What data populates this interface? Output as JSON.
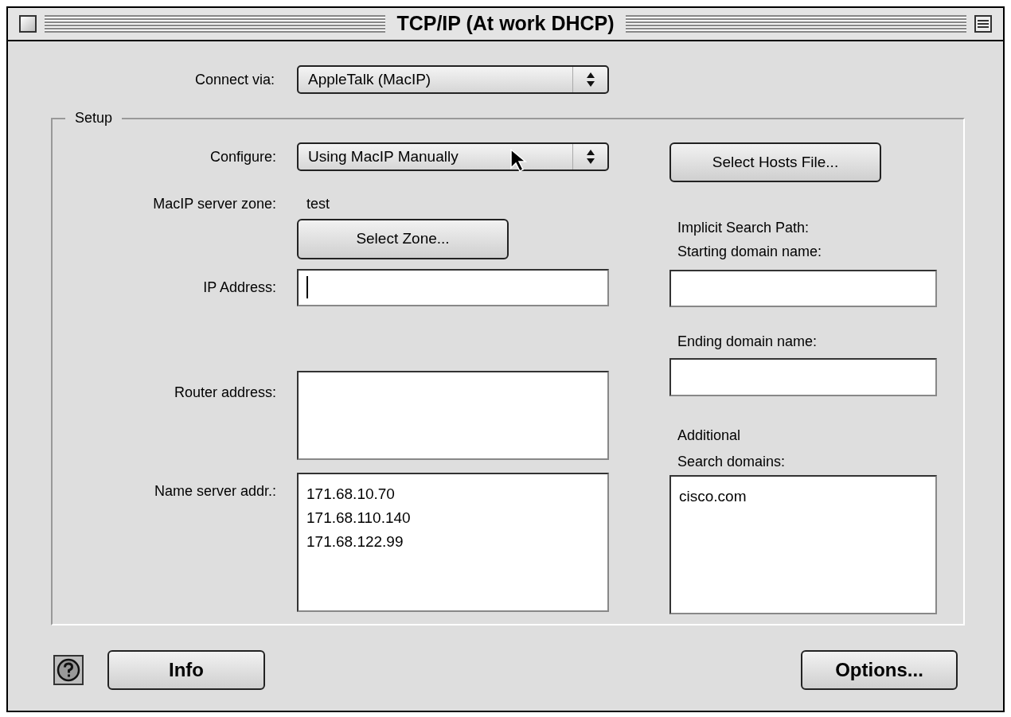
{
  "window": {
    "title": "TCP/IP (At work DHCP)"
  },
  "connect_via": {
    "label": "Connect via:",
    "value": "AppleTalk (MacIP)"
  },
  "setup": {
    "legend": "Setup",
    "configure": {
      "label": "Configure:",
      "value": "Using MacIP Manually"
    },
    "server_zone": {
      "label": "MacIP server zone:",
      "value": "test"
    },
    "select_zone_button": "Select Zone...",
    "ip_address": {
      "label": "IP Address:",
      "focused": true
    },
    "router_address": {
      "label": "Router address:"
    },
    "name_server": {
      "label": "Name server addr.:",
      "lines": [
        "171.68.10.70",
        "171.68.110.140",
        "171.68.122.99"
      ]
    },
    "select_hosts_button": "Select Hosts File...",
    "implicit_search_path": "Implicit Search Path:",
    "starting_domain": {
      "label": "Starting domain name:"
    },
    "ending_domain": {
      "label": "Ending domain name:"
    },
    "additional_search_domains": {
      "label": "Additional\nSearch domains:",
      "lines": [
        "cisco.com"
      ]
    }
  },
  "buttons": {
    "info": "Info",
    "options": "Options..."
  }
}
